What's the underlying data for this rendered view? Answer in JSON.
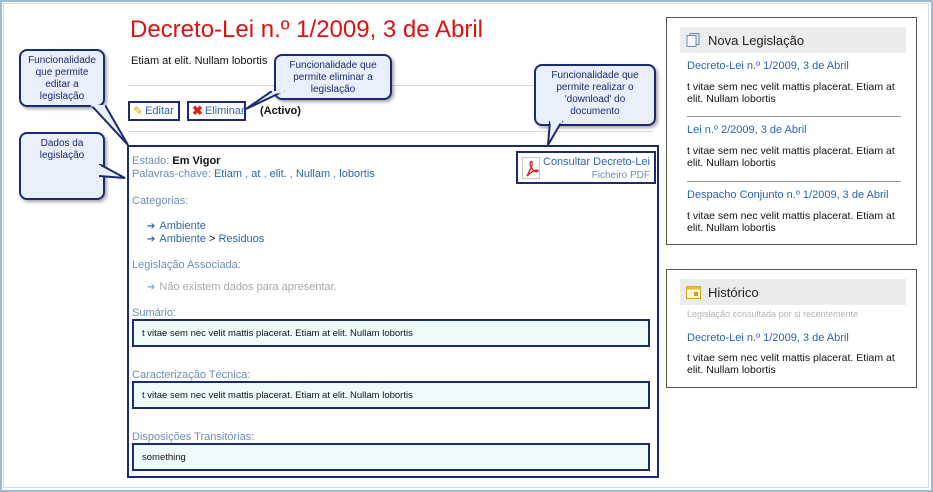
{
  "page": {
    "title": "Decreto-Lei n.º 1/2009, 3 de Abril",
    "subtitle": "Etiam at elit. Nullam lobortis"
  },
  "actions": {
    "edit_label": "Editar",
    "delete_label": "Eliminar",
    "status": "(Activo)"
  },
  "callouts": {
    "edit": "Funcionalidade que permite editar a legislação",
    "delete": "Funcionalidade que permite eliminar a legislação",
    "download": "Funcionalidade que permite realizar o 'download' do documento",
    "data": "Dados da legislação"
  },
  "details": {
    "estado_label": "Estado:",
    "estado_value": "Em Vigor",
    "palavras_label": "Palavras-chave:",
    "palavras": [
      "Etiam",
      "at",
      "elit.",
      "Nullam",
      "lobortis"
    ],
    "categorias_label": "Categorias:",
    "categorias": [
      {
        "parent": "Ambiente",
        "child": ""
      },
      {
        "parent": "Ambiente",
        "child": "Residuos"
      }
    ],
    "categoria_separator": ">",
    "legislacao_label": "Legislação Associada:",
    "legislacao_empty": "Não existem dados para apresentar.",
    "sumario_label": "Sumário:",
    "sumario_text": "t vitae sem nec velit mattis placerat. Etiam at elit. Nullam lobortis",
    "caracterizacao_label": "Caracterização Técnica:",
    "caracterizacao_text": "t vitae sem nec velit mattis placerat. Etiam at elit. Nullam lobortis",
    "disposicoes_label": "Disposições Transitórias:",
    "disposicoes_text": "something"
  },
  "pdf": {
    "title": "Consultar Decreto-Lei",
    "subtitle": "Ficheiro PDF",
    "icon": "pdf-icon"
  },
  "nova_legislacao": {
    "heading": "Nova Legislação",
    "icon": "documents-icon",
    "items": [
      {
        "title": "Decreto-Lei n.º 1/2009, 3 de Abril",
        "text": "t vitae sem nec velit mattis placerat. Etiam at elit. Nullam lobortis"
      },
      {
        "title": "Lei n.º 2/2009, 3 de Abril",
        "text": "t vitae sem nec velit mattis placerat. Etiam at elit. Nullam lobortis"
      },
      {
        "title": "Despacho Conjunto n.º 1/2009, 3 de Abril",
        "text": "t vitae sem nec velit mattis placerat. Etiam at elit. Nullam lobortis"
      }
    ]
  },
  "historico": {
    "heading": "Histórico",
    "icon": "calendar-icon",
    "subheading": "Legislação consultada por si recentemente",
    "items": [
      {
        "title": "Decreto-Lei n.º 1/2009, 3 de Abril",
        "text": "t vitae sem nec velit mattis placerat. Etiam at elit. Nullam lobortis"
      }
    ]
  },
  "colors": {
    "title": "#dd1111",
    "link": "#2b64b5",
    "callout_border": "#1b2a73",
    "label": "#6b8fba"
  }
}
